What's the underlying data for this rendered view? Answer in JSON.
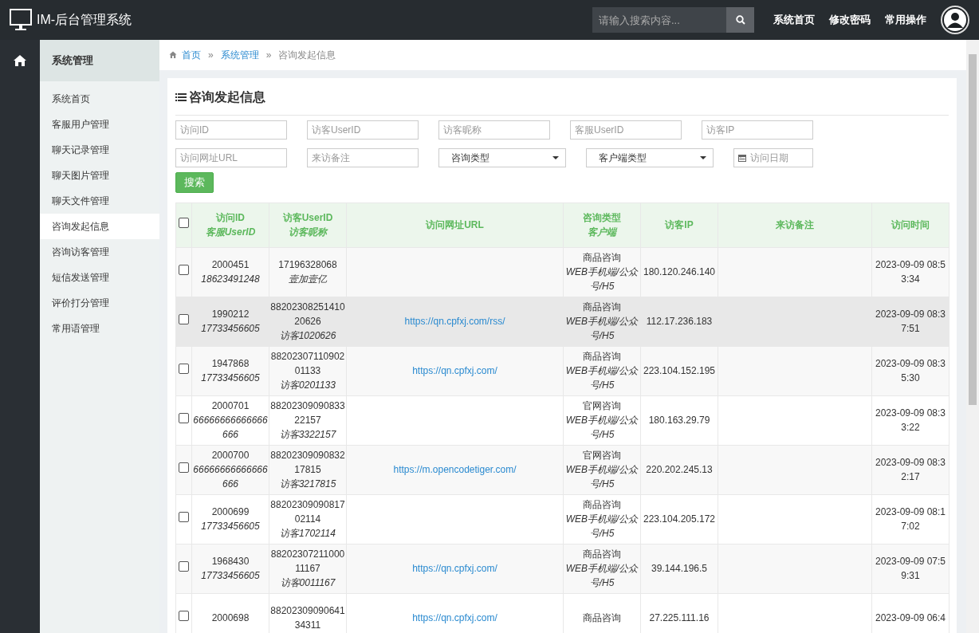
{
  "navbar": {
    "brand": "IM-后台管理系统",
    "search": {
      "placeholder": "请输入搜索内容..."
    },
    "links": [
      "系统首页",
      "修改密码",
      "常用操作"
    ]
  },
  "sidebar": {
    "title": "系统管理",
    "items": [
      {
        "label": "系统首页",
        "selected": false
      },
      {
        "label": "客服用户管理",
        "selected": false
      },
      {
        "label": "聊天记录管理",
        "selected": false
      },
      {
        "label": "聊天图片管理",
        "selected": false
      },
      {
        "label": "聊天文件管理",
        "selected": false
      },
      {
        "label": "咨询发起信息",
        "selected": true
      },
      {
        "label": "咨询访客管理",
        "selected": false
      },
      {
        "label": "短信发送管理",
        "selected": false
      },
      {
        "label": "评价打分管理",
        "selected": false
      },
      {
        "label": "常用语管理",
        "selected": false
      }
    ]
  },
  "breadcrumb": [
    {
      "label": "首页",
      "kind": "link"
    },
    {
      "label": "系统管理",
      "kind": "link"
    },
    {
      "label": "咨询发起信息",
      "kind": "current"
    }
  ],
  "breadcrumb_separator": "»",
  "panel": {
    "title": "咨询发起信息",
    "filters": [
      {
        "kind": "text",
        "placeholder": "访问ID"
      },
      {
        "kind": "text",
        "placeholder": "访客UserID"
      },
      {
        "kind": "text",
        "placeholder": "访客昵称"
      },
      {
        "kind": "text",
        "placeholder": "客服UserID"
      },
      {
        "kind": "text",
        "placeholder": "访客IP"
      },
      {
        "kind": "text",
        "placeholder": "访问网址URL"
      },
      {
        "kind": "text",
        "placeholder": "来访备注"
      },
      {
        "kind": "select",
        "value": "咨询类型"
      },
      {
        "kind": "select",
        "value": "客户端类型"
      },
      {
        "kind": "date",
        "placeholder": "访问日期"
      }
    ],
    "search_button": "搜索"
  },
  "table": {
    "header_checked": false,
    "columns": [
      {
        "label": "访问ID",
        "sublabel": "客服UserID"
      },
      {
        "label": "访客UserID",
        "sublabel": "访客昵称"
      },
      {
        "label": "访问网址URL"
      },
      {
        "label": "咨询类型",
        "sublabel": "客户端"
      },
      {
        "label": "访客IP"
      },
      {
        "label": "来访备注"
      },
      {
        "label": "访问时间"
      }
    ],
    "rows": [
      {
        "checked": false,
        "hovered": false,
        "visit_id": "2000451",
        "agent_user_id": "18623491248",
        "visitor_user_id": "17196328068",
        "nickname": "壹加壹亿",
        "consult_type": "商品咨询",
        "client": "WEB手机端/公众号/H5",
        "ip": "180.120.246.140",
        "time": "2023-09-09 08:53:34"
      },
      {
        "checked": false,
        "hovered": true,
        "visit_id": "1990212",
        "agent_user_id": "17733456605",
        "visitor_user_id": "8820230825141020626",
        "nickname": "访客1020626",
        "url": "https://qn.cpfxj.com/rss/",
        "consult_type": "商品咨询",
        "client": "WEB手机端/公众号/H5",
        "ip": "112.17.236.183",
        "time": "2023-09-09 08:37:51"
      },
      {
        "checked": false,
        "hovered": false,
        "visit_id": "1947868",
        "agent_user_id": "17733456605",
        "visitor_user_id": "8820230711090201133",
        "nickname": "访客0201133",
        "url": "https://qn.cpfxj.com/",
        "consult_type": "商品咨询",
        "client": "WEB手机端/公众号/H5",
        "ip": "223.104.152.195",
        "time": "2023-09-09 08:35:30"
      },
      {
        "checked": false,
        "hovered": false,
        "visit_id": "2000701",
        "agent_user_id": "66666666666666666",
        "visitor_user_id": "8820230909083322157",
        "nickname": "访客3322157",
        "consult_type": "官网咨询",
        "client": "WEB手机端/公众号/H5",
        "ip": "180.163.29.79",
        "time": "2023-09-09 08:33:22"
      },
      {
        "checked": false,
        "hovered": false,
        "visit_id": "2000700",
        "agent_user_id": "66666666666666666",
        "visitor_user_id": "8820230909083217815",
        "nickname": "访客3217815",
        "url": "https://m.opencodetiger.com/",
        "consult_type": "官网咨询",
        "client": "WEB手机端/公众号/H5",
        "ip": "220.202.245.13",
        "time": "2023-09-09 08:32:17"
      },
      {
        "checked": false,
        "hovered": false,
        "visit_id": "2000699",
        "agent_user_id": "17733456605",
        "visitor_user_id": "8820230909081702114",
        "nickname": "访客1702114",
        "consult_type": "商品咨询",
        "client": "WEB手机端/公众号/H5",
        "ip": "223.104.205.172",
        "time": "2023-09-09 08:17:02"
      },
      {
        "checked": false,
        "hovered": false,
        "visit_id": "1968430",
        "agent_user_id": "17733456605",
        "visitor_user_id": "8820230721100011167",
        "nickname": "访客0011167",
        "url": "https://qn.cpfxj.com/",
        "consult_type": "商品咨询",
        "client": "WEB手机端/公众号/H5",
        "ip": "39.144.196.5",
        "time": "2023-09-09 07:59:31"
      },
      {
        "checked": false,
        "hovered": false,
        "visit_id": "2000698",
        "visitor_user_id": "8820230909064134311",
        "url": "https://qn.cpfxj.com/",
        "consult_type": "商品咨询",
        "ip": "27.225.111.16",
        "time": "2023-09-09 06:4"
      }
    ]
  }
}
